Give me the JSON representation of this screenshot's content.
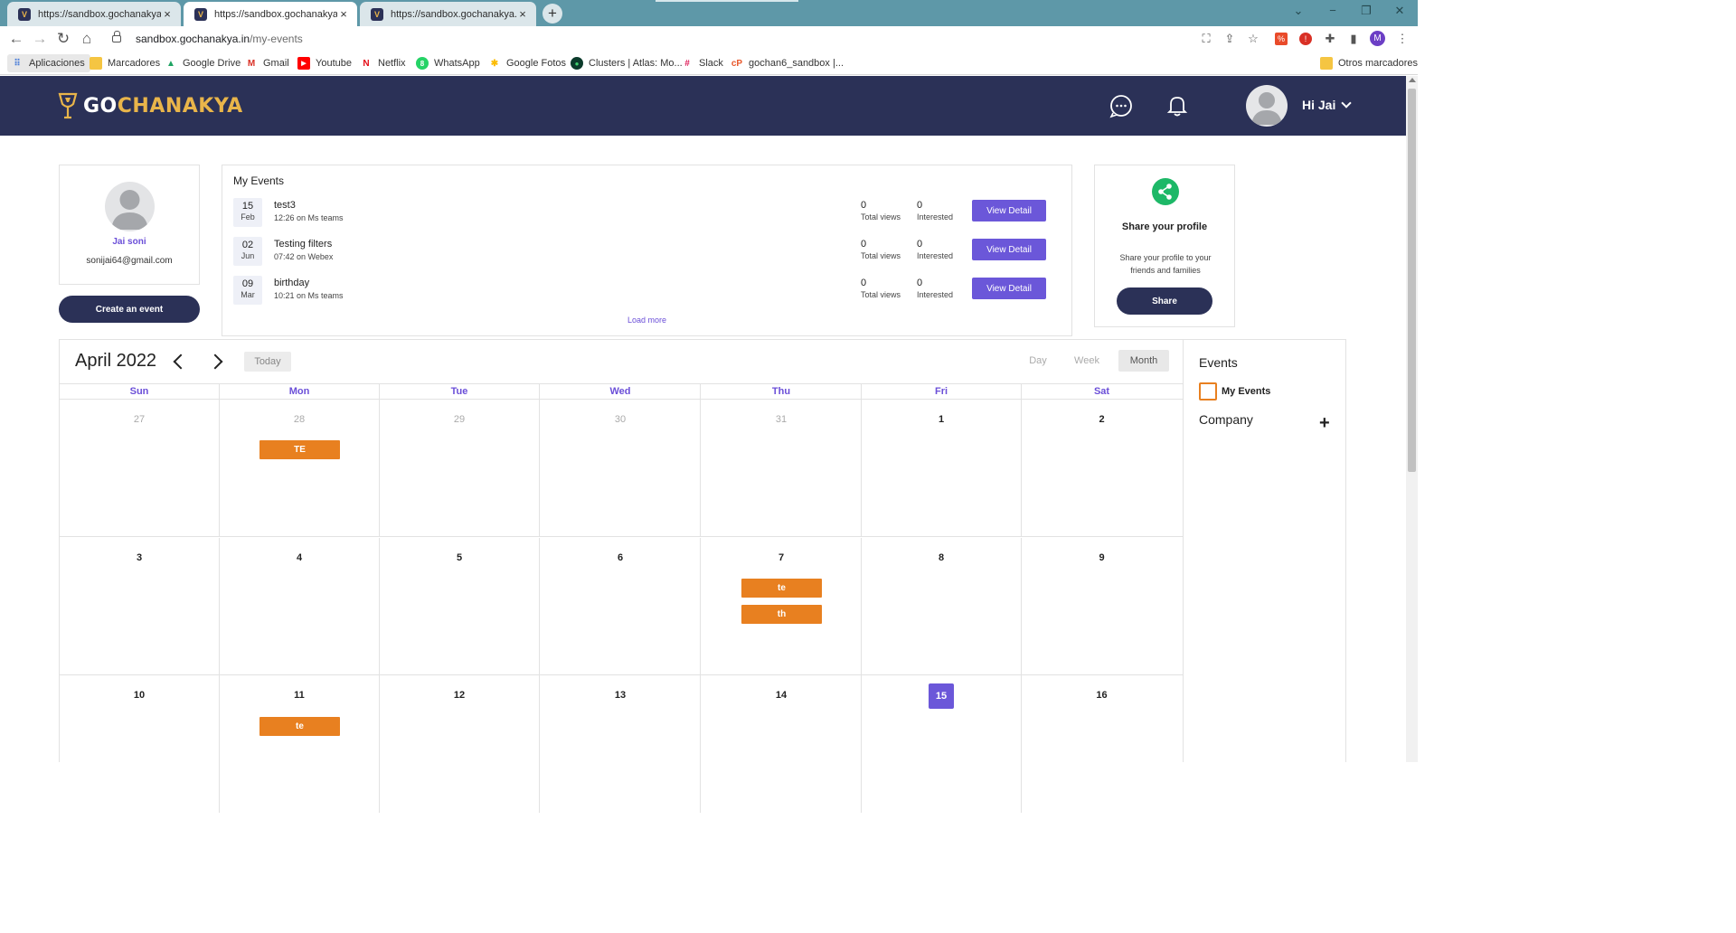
{
  "browser": {
    "tabs": [
      {
        "title": "https://sandbox.gochanakya.in/m",
        "active": false
      },
      {
        "title": "https://sandbox.gochanakya.in/m",
        "active": true
      },
      {
        "title": "https://sandbox.gochanakya.in/w",
        "active": false
      }
    ],
    "favicon_letter": "V",
    "tab_close": "×",
    "new_tab": "+",
    "url_host": "sandbox.gochanakya.in",
    "url_path": "/my-events",
    "profile_letter": "M",
    "bookmarks": [
      "Aplicaciones",
      "Marcadores",
      "Google Drive",
      "Gmail",
      "Youtube",
      "Netflix",
      "WhatsApp",
      "Google Fotos",
      "Clusters | Atlas: Mo...",
      "Slack",
      "gochan6_sandbox |..."
    ],
    "other_bookmarks": "Otros marcadores"
  },
  "header": {
    "brand_go": "GO",
    "brand_rest": "CHANAKYA",
    "greeting": "Hi Jai"
  },
  "profile": {
    "name": "Jai soni",
    "email": "sonijai64@gmail.com",
    "create_button": "Create an event"
  },
  "my_events": {
    "title": "My Events",
    "views_label": "Total views",
    "interested_label": "Interested",
    "view_button": "View Detail",
    "load_more": "Load more",
    "items": [
      {
        "day": "15",
        "month": "Feb",
        "name": "test3",
        "time": "12:26 on Ms teams",
        "views": "0",
        "interested": "0"
      },
      {
        "day": "02",
        "month": "Jun",
        "name": "Testing filters",
        "time": "07:42 on Webex",
        "views": "0",
        "interested": "0"
      },
      {
        "day": "09",
        "month": "Mar",
        "name": "birthday",
        "time": "10:21 on Ms teams",
        "views": "0",
        "interested": "0"
      }
    ]
  },
  "share": {
    "title": "Share your profile",
    "description": "Share your profile to your friends and families",
    "button": "Share"
  },
  "calendar": {
    "title": "April 2022",
    "today_button": "Today",
    "views": [
      "Day",
      "Week",
      "Month"
    ],
    "active_view": "Month",
    "weekdays": [
      "Sun",
      "Mon",
      "Tue",
      "Wed",
      "Thu",
      "Fri",
      "Sat"
    ],
    "weeks": [
      [
        {
          "n": "27",
          "muted": true
        },
        {
          "n": "28",
          "muted": true,
          "events": [
            "TE"
          ]
        },
        {
          "n": "29",
          "muted": true
        },
        {
          "n": "30",
          "muted": true
        },
        {
          "n": "31",
          "muted": true
        },
        {
          "n": "1"
        },
        {
          "n": "2"
        }
      ],
      [
        {
          "n": "3"
        },
        {
          "n": "4"
        },
        {
          "n": "5"
        },
        {
          "n": "6"
        },
        {
          "n": "7",
          "events": [
            "te",
            "th"
          ]
        },
        {
          "n": "8"
        },
        {
          "n": "9"
        }
      ],
      [
        {
          "n": "10"
        },
        {
          "n": "11",
          "events": [
            "te"
          ]
        },
        {
          "n": "12"
        },
        {
          "n": "13"
        },
        {
          "n": "14"
        },
        {
          "n": "15",
          "today": true
        },
        {
          "n": "16"
        }
      ]
    ],
    "event_color": "#e88020",
    "accent_color": "#6b57d9"
  },
  "filters": {
    "title": "Events",
    "my_events_label": "My Events",
    "company_label": "Company",
    "add_icon": "+"
  },
  "colors": {
    "header_bg": "#2b3157",
    "brand_gold": "#e9b54a",
    "share_green": "#1db867"
  }
}
